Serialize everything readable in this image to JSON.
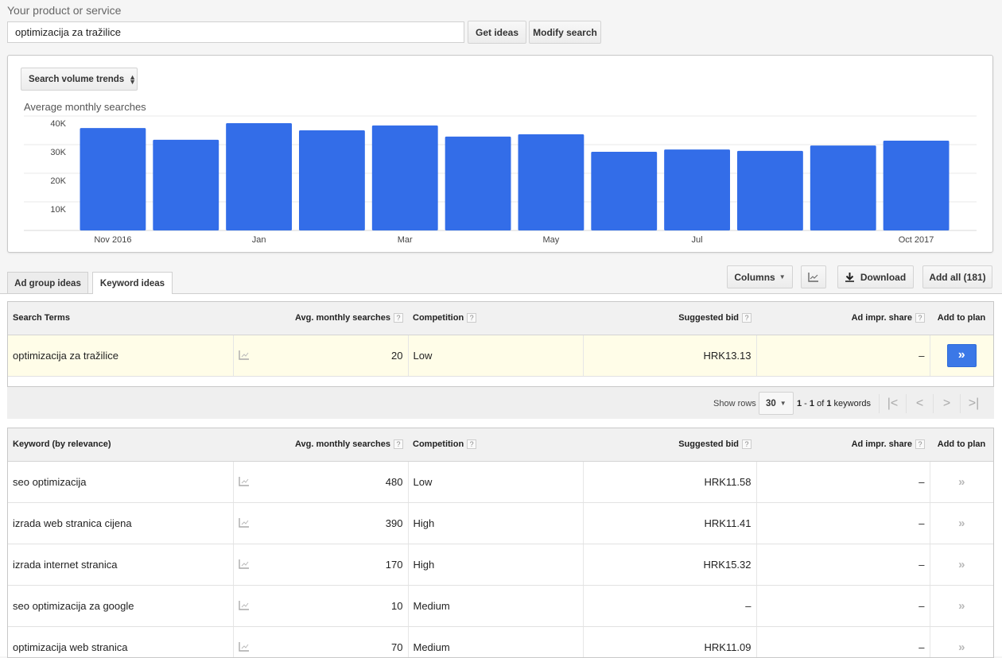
{
  "search": {
    "label": "Your product or service",
    "value": "optimizacija za tražilice",
    "get_ideas_label": "Get ideas",
    "modify_search_label": "Modify search"
  },
  "chart_panel": {
    "select_label": "Search volume trends",
    "select_icon": "up-down-arrows-icon"
  },
  "chart_data": {
    "type": "bar",
    "title": "Average monthly searches",
    "xlabel": "",
    "ylabel": "",
    "categories": [
      "Nov 2016",
      "Dec 2016",
      "Jan 2017",
      "Feb 2017",
      "Mar 2017",
      "Apr 2017",
      "May 2017",
      "Jun 2017",
      "Jul 2017",
      "Aug 2017",
      "Sep 2017",
      "Oct 2017"
    ],
    "values": [
      35800,
      31700,
      37500,
      35000,
      36700,
      32800,
      33600,
      27500,
      28300,
      27800,
      29700,
      31400
    ],
    "x_tick_labels": [
      "Nov 2016",
      "",
      "Jan",
      "",
      "Mar",
      "",
      "May",
      "",
      "Jul",
      "",
      "",
      "Oct 2017"
    ],
    "y_ticks": [
      10000,
      20000,
      30000,
      40000
    ],
    "y_tick_labels": [
      "10K",
      "20K",
      "30K",
      "40K"
    ],
    "ylim": [
      0,
      40000
    ],
    "grid": true,
    "bar_color": "#336de8"
  },
  "tabs": [
    {
      "label": "Ad group ideas",
      "active": false
    },
    {
      "label": "Keyword ideas",
      "active": true
    }
  ],
  "toolbar": {
    "columns_label": "Columns",
    "chart_icon": "line-chart-icon",
    "download_label": "Download",
    "download_icon": "download-arrow-icon",
    "add_all_label": "Add all (181)"
  },
  "search_terms_table": {
    "headers": {
      "term": "Search Terms",
      "avg": "Avg. monthly searches",
      "competition": "Competition",
      "bid": "Suggested bid",
      "impr": "Ad impr. share",
      "add": "Add to plan"
    },
    "help_mark": "?",
    "rows": [
      {
        "term": "optimizacija za tražilice",
        "avg": "20",
        "competition": "Low",
        "bid": "HRK13.13",
        "impr": "–",
        "add": "»"
      }
    ]
  },
  "pagination": {
    "show_rows_label": "Show rows",
    "rows_value": "30",
    "range_start": "1",
    "range_end": "1",
    "range_of": "of",
    "total": "1",
    "unit": "keywords",
    "first_icon": "|<",
    "prev_icon": "<",
    "next_icon": ">",
    "last_icon": ">|"
  },
  "keyword_table": {
    "headers": {
      "term": "Keyword (by relevance)",
      "avg": "Avg. monthly searches",
      "competition": "Competition",
      "bid": "Suggested bid",
      "impr": "Ad impr. share",
      "add": "Add to plan"
    },
    "rows": [
      {
        "term": "seo optimizacija",
        "avg": "480",
        "competition": "Low",
        "bid": "HRK11.58",
        "impr": "–",
        "add": "»"
      },
      {
        "term": "izrada web stranica cijena",
        "avg": "390",
        "competition": "High",
        "bid": "HRK11.41",
        "impr": "–",
        "add": "»"
      },
      {
        "term": "izrada internet stranica",
        "avg": "170",
        "competition": "High",
        "bid": "HRK15.32",
        "impr": "–",
        "add": "»"
      },
      {
        "term": "seo optimizacija za google",
        "avg": "10",
        "competition": "Medium",
        "bid": "–",
        "impr": "–",
        "add": "»"
      },
      {
        "term": "optimizacija web stranica",
        "avg": "70",
        "competition": "Medium",
        "bid": "HRK11.09",
        "impr": "–",
        "add": "»"
      }
    ]
  }
}
